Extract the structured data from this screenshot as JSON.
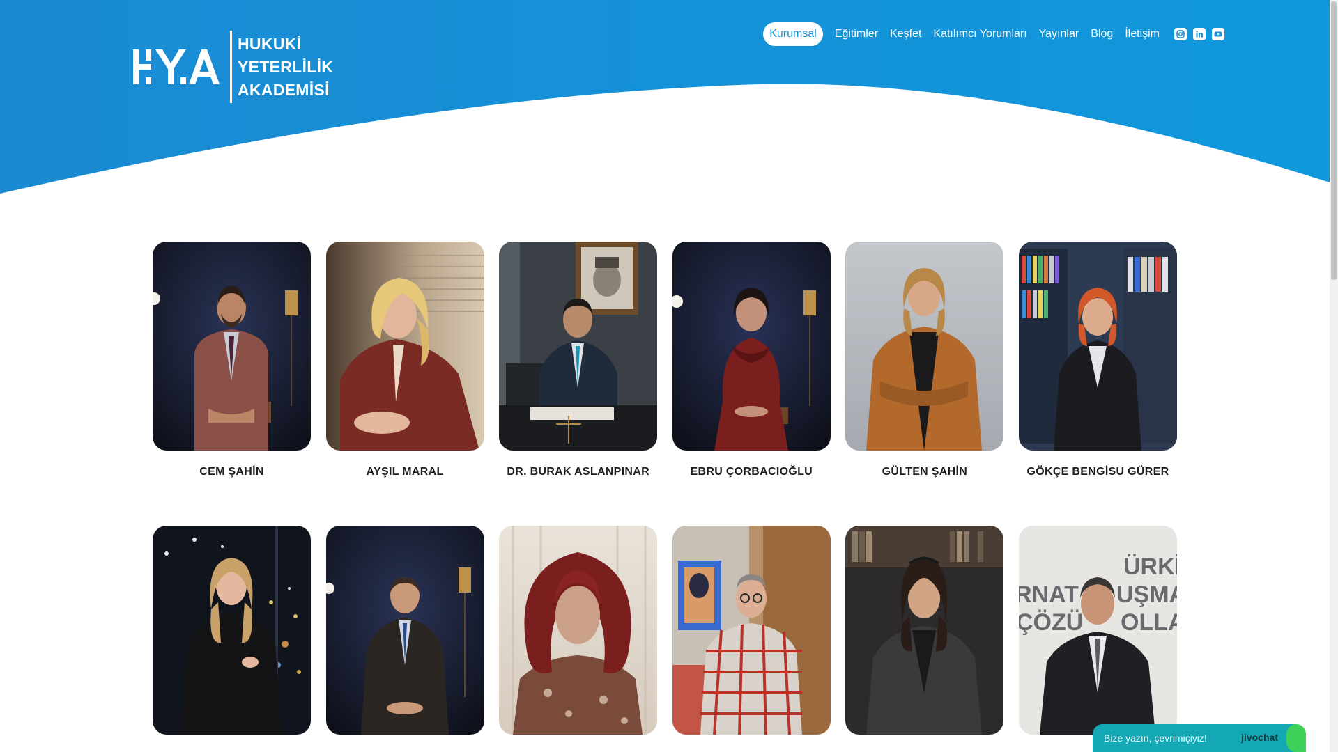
{
  "brand": {
    "logo_mark": "H.Y.A",
    "lines": [
      "HUKUKİ",
      "YETERLİLİK",
      "AKADEMİSİ"
    ]
  },
  "nav": {
    "items": [
      "Kurumsal",
      "Eğitimler",
      "Keşfet",
      "Katılımcı Yorumları",
      "Yayınlar",
      "Blog",
      "İletişim"
    ],
    "active": "Kurumsal",
    "socials": [
      "instagram-icon",
      "linkedin-icon",
      "youtube-icon"
    ]
  },
  "instructors": [
    {
      "name": "CEM ŞAHİN",
      "photo": "man-seated-dark-studio"
    },
    {
      "name": "AYŞIL MARAL",
      "photo": "woman-blonde-speaking"
    },
    {
      "name": "DR. BURAK ASLANPINAR",
      "photo": "man-at-desk-with-portrait"
    },
    {
      "name": "EBRU ÇORBACIOĞLU",
      "photo": "woman-seated-dark-studio"
    },
    {
      "name": "GÜLTEN ŞAHİN",
      "photo": "woman-arms-crossed-grey"
    },
    {
      "name": "GÖKÇE BENGİSU GÜRER",
      "photo": "woman-redhead-bookshelf"
    },
    {
      "name": "",
      "photo": "woman-city-night"
    },
    {
      "name": "",
      "photo": "man-seated-dark-studio"
    },
    {
      "name": "",
      "photo": "woman-curly-red-hair"
    },
    {
      "name": "",
      "photo": "man-plaid-shirt"
    },
    {
      "name": "",
      "photo": "woman-dark-hair-library"
    },
    {
      "name": "",
      "photo": "man-suit-banner"
    }
  ],
  "chat": {
    "prompt": "Bize yazın, çevrimiçiyiz!",
    "brand": "jivochat"
  },
  "colors": {
    "hero_blue": "#1a8fd4",
    "white": "#ffffff",
    "chat_teal": "#13a8b4",
    "chat_green": "#3ed15a"
  }
}
